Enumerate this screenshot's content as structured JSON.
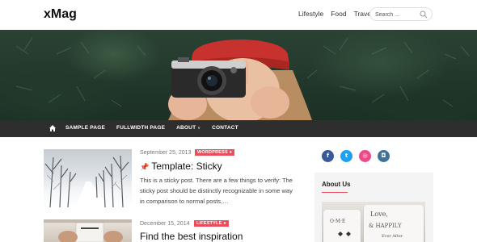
{
  "header": {
    "site_title": "xMag",
    "top_nav": [
      "Lifestyle",
      "Food",
      "Travel"
    ],
    "search_placeholder": "Search ..."
  },
  "main_nav": {
    "home_icon": "home-icon",
    "items": [
      "SAMPLE PAGE",
      "FULLWIDTH PAGE",
      "ABOUT",
      "CONTACT"
    ]
  },
  "posts": [
    {
      "date": "September 25, 2013",
      "category": "WORDPRESS",
      "pin_icon": "pin-icon",
      "title": "Template: Sticky",
      "excerpt": "This is a sticky post. There are a few things to verify: The sticky post should be distinctly recognizable in some way in comparison to normal posts,…"
    },
    {
      "date": "December 15, 2014",
      "category": "LIFESTYLE",
      "title": "Find the best inspiration"
    }
  ],
  "sidebar": {
    "social": [
      {
        "name": "facebook-icon",
        "glyph": "f",
        "color": "#3b5998"
      },
      {
        "name": "twitter-icon",
        "glyph": "t",
        "color": "#1da1f2"
      },
      {
        "name": "dribbble-icon",
        "glyph": "◎",
        "color": "#ea4c89"
      },
      {
        "name": "instagram-icon",
        "glyph": "◘",
        "color": "#3f729b"
      }
    ],
    "widget_title": "About Us"
  },
  "colors": {
    "accent": "#e84e5c",
    "nav_bg": "#2e2e2e"
  }
}
